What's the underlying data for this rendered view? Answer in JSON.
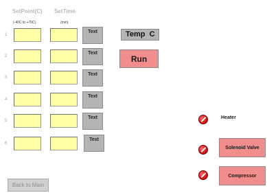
{
  "headers": {
    "setpoint": "SetPoint(C)",
    "settime": "SetTime",
    "setpoint_range": "(-40C to +70C)",
    "settime_unit": "(min)"
  },
  "rows": [
    {
      "num": "1",
      "setpoint": "",
      "settime": "",
      "text": "Text"
    },
    {
      "num": "2",
      "setpoint": "",
      "settime": "",
      "text": "Text"
    },
    {
      "num": "3",
      "setpoint": "",
      "settime": "",
      "text": "Text"
    },
    {
      "num": "4",
      "setpoint": "",
      "settime": "",
      "text": "Text"
    },
    {
      "num": "5",
      "setpoint": "",
      "settime": "",
      "text": "Text"
    },
    {
      "num": "6",
      "setpoint": "",
      "settime": "",
      "text": "Text"
    }
  ],
  "temp_display": "Temp  C",
  "run_label": "Run",
  "indicators": {
    "heater": {
      "label": "Heater",
      "color": "#e01818"
    },
    "solenoid": {
      "label": "Solenoid Valve",
      "color": "#e01818"
    },
    "compressor": {
      "label": "Compressor",
      "color": "#e01818"
    }
  },
  "back_label": "Back to Main",
  "colors": {
    "input_bg": "#ffffa8",
    "button_pink": "#f28d8d",
    "display_gray": "#b4b4b4"
  }
}
